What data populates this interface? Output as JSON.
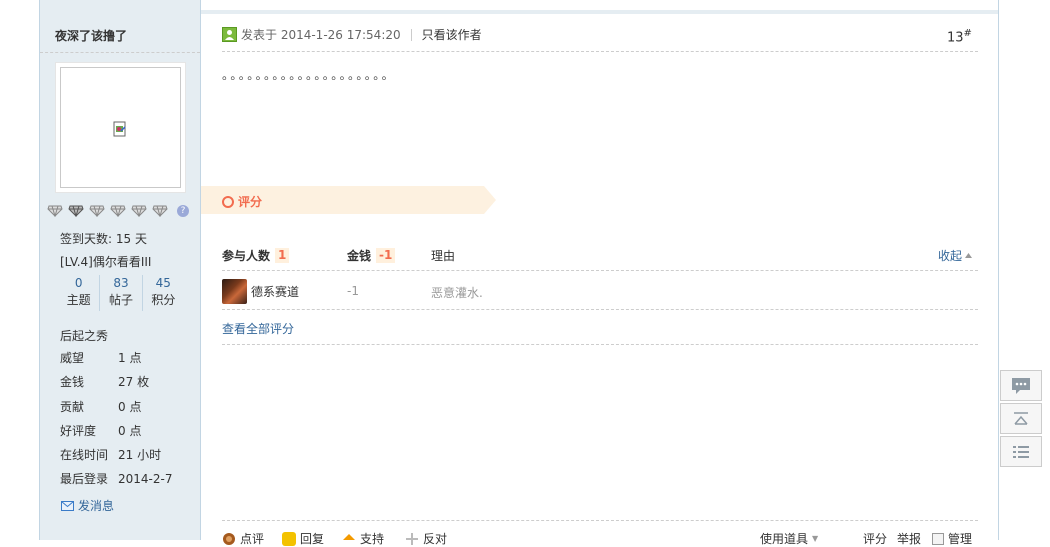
{
  "user": {
    "name": "夜深了该撸了",
    "signin": "签到天数: 15 天",
    "level": "[LV.4]偶尔看看III",
    "stats": [
      {
        "num": "0",
        "label": "主题"
      },
      {
        "num": "83",
        "label": "帖子"
      },
      {
        "num": "45",
        "label": "积分"
      }
    ],
    "group": "后起之秀",
    "info": [
      {
        "k": "威望",
        "v": "1 点"
      },
      {
        "k": "金钱",
        "v": "27 枚"
      },
      {
        "k": "贡献",
        "v": "0 点"
      },
      {
        "k": "好评度",
        "v": "0 点"
      },
      {
        "k": "在线时间",
        "v": "21 小时"
      },
      {
        "k": "最后登录",
        "v": "2014-2-7"
      }
    ],
    "send_message": "发消息",
    "help_mark": "?"
  },
  "post": {
    "posted_at": "发表于 2014-1-26 17:54:20",
    "only_author": "只看该作者",
    "floor": "13",
    "floor_mark": "#",
    "content": "。。。。。。。。。。。。。。。。。。。。"
  },
  "rating": {
    "label": "评分",
    "participants_label": "参与人数",
    "participants": "1",
    "money_label": "金钱",
    "money_total": "-1",
    "reason_label": "理由",
    "collapse": "收起",
    "rows": [
      {
        "name": "德系赛道",
        "value": "-1",
        "reason": "恶意灌水."
      }
    ],
    "view_all": "查看全部评分"
  },
  "actions": {
    "comment": "点评",
    "reply": "回复",
    "support": "支持",
    "oppose": "反对",
    "use_item": "使用道具",
    "rate": "评分",
    "report": "举报",
    "manage": "管理"
  },
  "colors": {
    "accent_link": "#336699",
    "rate_orange": "#f26c4f",
    "sidebar_bg": "#e5edf2"
  }
}
